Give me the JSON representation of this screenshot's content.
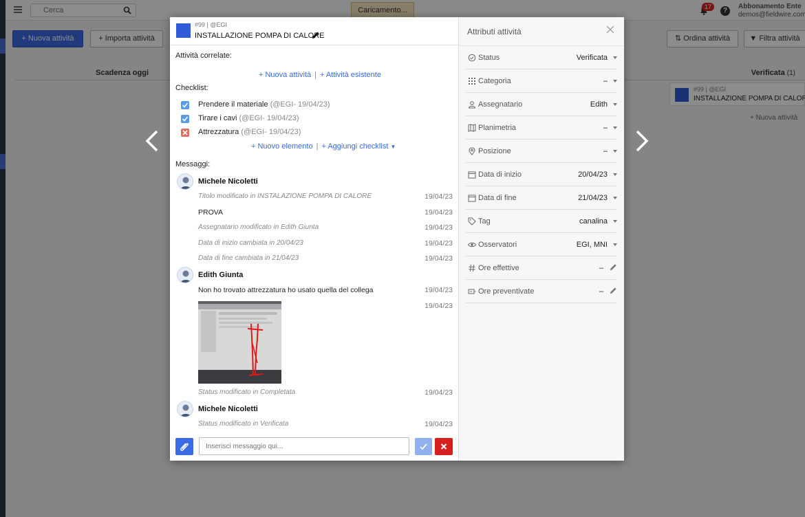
{
  "topbar": {
    "search_placeholder": "Cerca",
    "loading_label": "Caricamento...",
    "notification_count": "17",
    "help_label": "?",
    "account_plan": "Abbonamento Ente",
    "account_email": "demos@fieldwire.com"
  },
  "toolbar": {
    "new_activity": "Nuova attività",
    "import_activities": "Importa attività",
    "sort_activities": "Ordina attività",
    "filter_activities": "Filtra attività"
  },
  "board": {
    "col_left_title": "Scadenza oggi",
    "col_right_title": "Verificata",
    "col_right_count": "(1)",
    "card_id": "#99 | @EGI",
    "card_title": "INSTALLAZIONE POMPA DI CALORE",
    "add_activity": "+ Nuova attività"
  },
  "modal": {
    "id": "#99 | @EGI",
    "title": "INSTALLAZIONE POMPA DI CALORE",
    "related_label": "Attività correlate:",
    "related_new": "+ Nuova attività",
    "related_existing": "+ Attività esistente",
    "checklist_label": "Checklist:",
    "checklist": [
      {
        "text": "Prendere il materiale",
        "meta": "(@EGI- 19/04/23)",
        "state": "done"
      },
      {
        "text": "Tirare i cavi",
        "meta": "(@EGI- 19/04/23)",
        "state": "done"
      },
      {
        "text": "Attrezzatura",
        "meta": "(@EGI- 19/04/23)",
        "state": "failed"
      }
    ],
    "new_item": "+ Nuovo elemento",
    "add_checklist": "+ Aggiungi checklist",
    "messages_label": "Messaggi:",
    "messages": {
      "author1": "Michele Nicoletti",
      "m1": {
        "text": "Titolo modificato in INSTALAZIONE POMPA DI CALORE",
        "date": "19/04/23"
      },
      "m2": {
        "text": "PROVA",
        "date": "19/04/23"
      },
      "m3": {
        "text": "Assegnatario modificato in Edith Giunta",
        "date": "19/04/23"
      },
      "m4": {
        "text": "Data di inizio cambiata in 20/04/23",
        "date": "19/04/23"
      },
      "m5": {
        "text": "Data di fine cambiata in 21/04/23",
        "date": "19/04/23"
      },
      "author2": "Edith Giunta",
      "m6": {
        "text": "Non ho trovato attrezzatura ho usato quella del collega",
        "date": "19/04/23"
      },
      "m7": {
        "date": "19/04/23"
      },
      "m8": {
        "text": "Status modificato in Completata",
        "date": "19/04/23"
      },
      "author3": "Michele Nicoletti",
      "m9": {
        "text": "Status modificato in Verificata",
        "date": "19/04/23"
      }
    },
    "message_placeholder": "Inserisci messaggio qui..."
  },
  "attributes": {
    "title": "Attributi attività",
    "status": {
      "label": "Status",
      "value": "Verificata"
    },
    "category": {
      "label": "Categoria",
      "value": "–"
    },
    "assignee": {
      "label": "Assegnatario",
      "value": "Edith"
    },
    "plan": {
      "label": "Planimetria",
      "value": "–"
    },
    "position": {
      "label": "Posizione",
      "value": "–"
    },
    "start_date": {
      "label": "Data di inizio",
      "value": "20/04/23"
    },
    "end_date": {
      "label": "Data di fine",
      "value": "21/04/23"
    },
    "tag": {
      "label": "Tag",
      "value": "canalina"
    },
    "observers": {
      "label": "Osservatori",
      "value": "EGI, MNI"
    },
    "actual_hours": {
      "label": "Ore effettive",
      "value": "–"
    },
    "planned_hours": {
      "label": "Ore preventivate",
      "value": "–"
    }
  },
  "colors": {
    "accent": "#3b6be4",
    "task_color": "#2f5bd8",
    "cancel": "#d62020",
    "check_done": "#5a9be8",
    "check_failed": "#e07060"
  }
}
